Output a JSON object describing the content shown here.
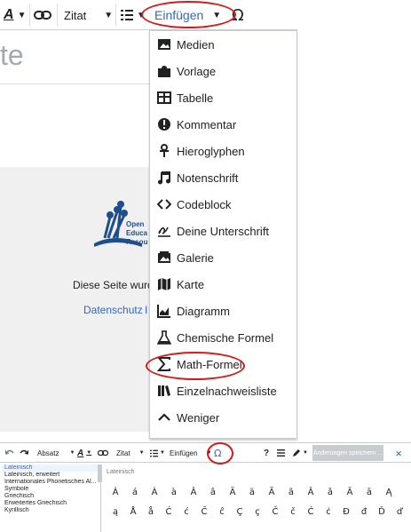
{
  "toolbar": {
    "style_label": "Zitat",
    "insert_label": "Einfügen",
    "omega_symbol": "Ω"
  },
  "page": {
    "title_fragment": "te",
    "logo_text": [
      "Open",
      "Educa",
      "Resou"
    ],
    "footer_text": "Diese Seite wurde z",
    "footer_link_privacy": "Datenschutz",
    "footer_link_cut": "I"
  },
  "insert_menu": {
    "items": [
      {
        "label": "Medien",
        "icon": "image-icon"
      },
      {
        "label": "Vorlage",
        "icon": "puzzle-icon"
      },
      {
        "label": "Tabelle",
        "icon": "table-icon"
      },
      {
        "label": "Kommentar",
        "icon": "exclamation-icon"
      },
      {
        "label": "Hieroglyphen",
        "icon": "ankh-icon"
      },
      {
        "label": "Notenschrift",
        "icon": "music-note-icon"
      },
      {
        "label": "Codeblock",
        "icon": "code-icon"
      },
      {
        "label": "Deine Unterschrift",
        "icon": "signature-icon"
      },
      {
        "label": "Galerie",
        "icon": "gallery-icon"
      },
      {
        "label": "Karte",
        "icon": "map-icon"
      },
      {
        "label": "Diagramm",
        "icon": "chart-icon"
      },
      {
        "label": "Chemische Formel",
        "icon": "flask-icon"
      },
      {
        "label": "Math-Formel",
        "icon": "sigma-icon"
      },
      {
        "label": "Einzelnachweisliste",
        "icon": "books-icon"
      },
      {
        "label": "Weniger",
        "icon": "chevron-up-icon"
      }
    ]
  },
  "bottom_toolbar": {
    "paragraph_label": "Absatz",
    "style_label": "Zitat",
    "insert_label": "Einfügen",
    "omega_symbol": "Ω",
    "help_symbol": "?",
    "save_label": "Änderungen speichern ...",
    "close_symbol": "×"
  },
  "special_chars": {
    "categories": [
      {
        "label": "Lateinisch",
        "selected": true
      },
      {
        "label": "Lateinisch, erweitert",
        "selected": false
      },
      {
        "label": "Internationales Phonetisches Al...",
        "selected": false
      },
      {
        "label": "Symbole",
        "selected": false
      },
      {
        "label": "Griechisch",
        "selected": false
      },
      {
        "label": "Erweitertes Griechisch",
        "selected": false
      },
      {
        "label": "Kyrillisch",
        "selected": false
      }
    ],
    "group_heading": "Lateinisch",
    "rows": [
      [
        "Á",
        "á",
        "À",
        "à",
        "Â",
        "â",
        "Ä",
        "ä",
        "Ã",
        "ã",
        "Ǎ",
        "ǎ",
        "Ā",
        "ā",
        "Ą"
      ],
      [
        "ą",
        "Å",
        "å",
        "Ć",
        "ć",
        "Ĉ",
        "ĉ",
        "Ç",
        "ç",
        "Č",
        "č",
        "Ċ",
        "ċ",
        "Đ",
        "đ",
        "Ď",
        "ď"
      ]
    ]
  },
  "colors": {
    "accent": "#3366cc",
    "highlight_oval": "#d01c1c"
  }
}
